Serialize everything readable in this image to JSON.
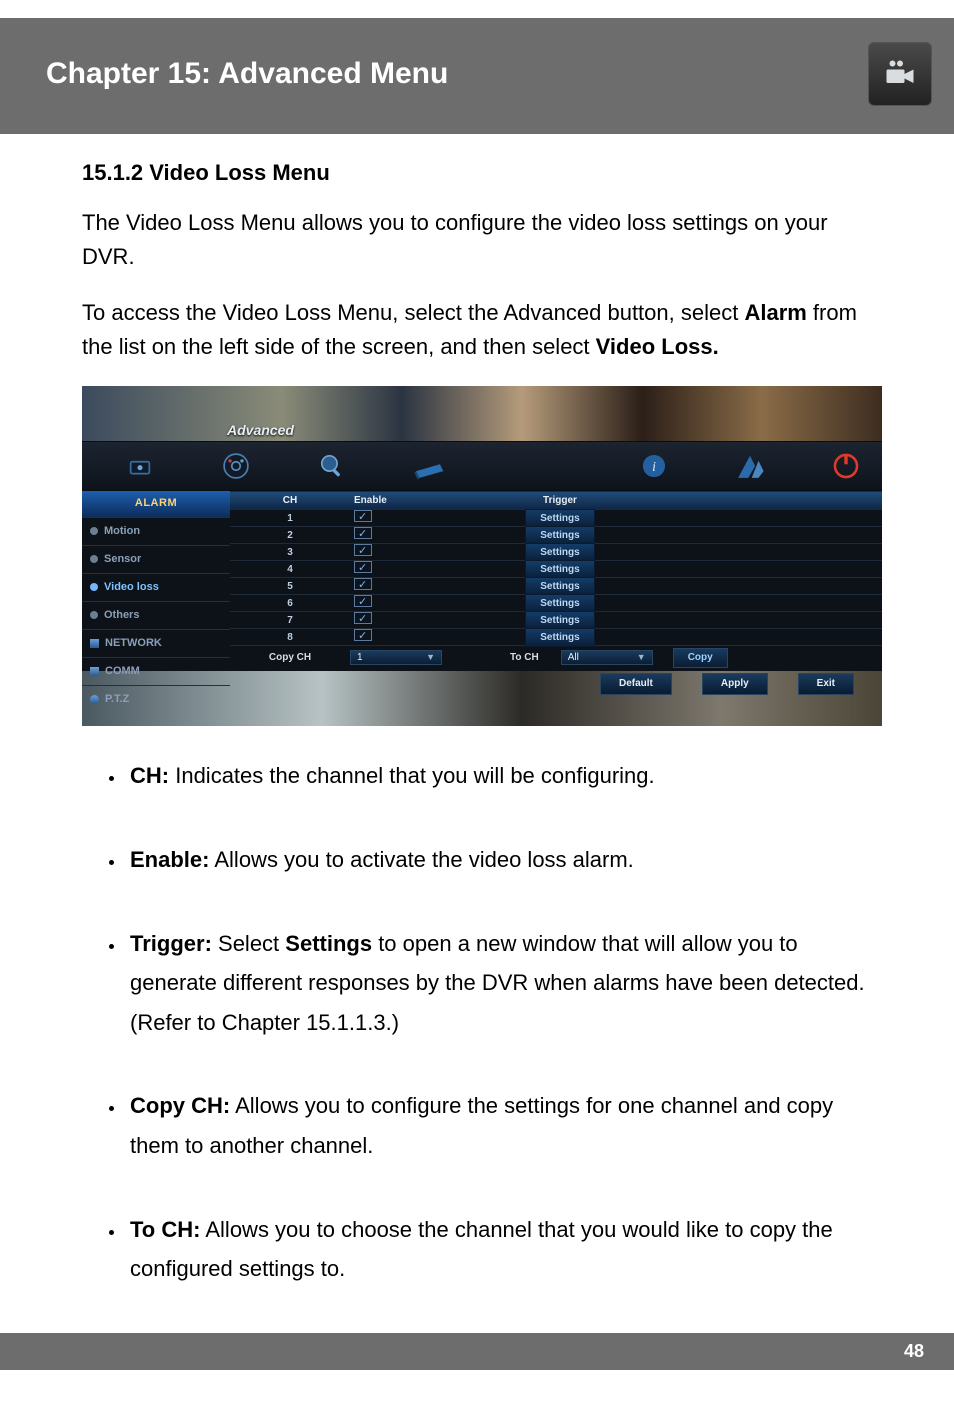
{
  "header": {
    "title": "Chapter 15: Advanced Menu"
  },
  "section_title": "15.1.2 Video Loss Menu",
  "intro_para": "The Video Loss Menu allows you to configure the video loss settings on your DVR.",
  "access_para_pre": "To access the Video Loss Menu, select the Advanced button, select ",
  "access_para_bold1": "Alarm",
  "access_para_mid": " from the list on the left side of the screen, and then select ",
  "access_para_bold2": "Video Loss.",
  "dvr": {
    "window_title": "Advanced",
    "sidebar": {
      "heading": "ALARM",
      "items": [
        {
          "label": "Motion"
        },
        {
          "label": "Sensor"
        },
        {
          "label": "Video loss"
        },
        {
          "label": "Others"
        },
        {
          "label": "NETWORK"
        },
        {
          "label": "COMM"
        },
        {
          "label": "P.T.Z"
        }
      ]
    },
    "table": {
      "headers": {
        "ch": "CH",
        "enable": "Enable",
        "trigger": "Trigger"
      },
      "rows": [
        {
          "ch": "1",
          "trigger": "Settings"
        },
        {
          "ch": "2",
          "trigger": "Settings"
        },
        {
          "ch": "3",
          "trigger": "Settings"
        },
        {
          "ch": "4",
          "trigger": "Settings"
        },
        {
          "ch": "5",
          "trigger": "Settings"
        },
        {
          "ch": "6",
          "trigger": "Settings"
        },
        {
          "ch": "7",
          "trigger": "Settings"
        },
        {
          "ch": "8",
          "trigger": "Settings"
        }
      ]
    },
    "copy": {
      "copy_ch_label": "Copy CH",
      "copy_ch_value": "1",
      "to_ch_label": "To CH",
      "to_ch_value": "All",
      "copy_btn": "Copy"
    },
    "actions": {
      "default": "Default",
      "apply": "Apply",
      "exit": "Exit"
    }
  },
  "bullets": [
    {
      "term": "CH:",
      "text": " Indicates the channel that you will be configuring."
    },
    {
      "term": "Enable:",
      "text": " Allows you to activate the video loss alarm."
    },
    {
      "term": "Trigger:",
      "pretext": " Select ",
      "bold2": "Settings",
      "text": " to open a new window that will allow you to generate different responses by the DVR when alarms have been detected. (Refer to Chapter 15.1.1.3.)"
    },
    {
      "term": "Copy CH:",
      "text": " Allows you to configure the settings for one channel and copy them to another channel."
    },
    {
      "term": "To CH:",
      "text": " Allows you to choose the channel that you would like to copy the configured settings to."
    }
  ],
  "page_number": "48"
}
